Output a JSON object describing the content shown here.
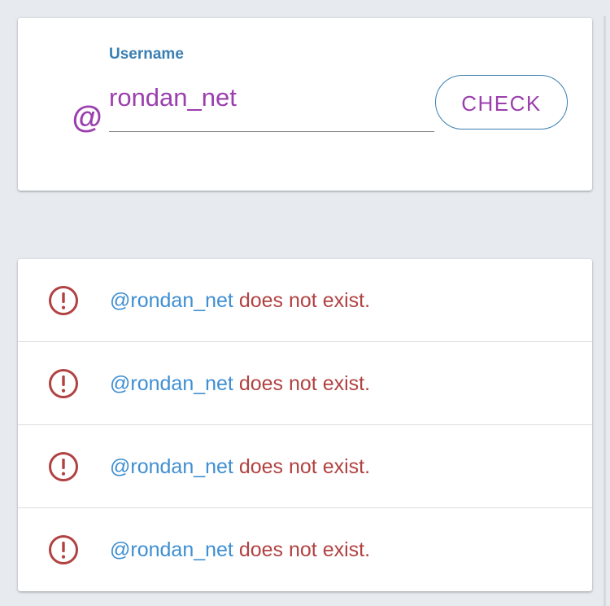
{
  "form": {
    "icon": "at-sign-icon",
    "at_symbol": "@",
    "label": "Username",
    "value": "rondan_net",
    "button_label": "CHECK"
  },
  "results": [
    {
      "icon": "alert-circle-icon",
      "handle": "@rondan_net",
      "message": "does not exist."
    },
    {
      "icon": "alert-circle-icon",
      "handle": "@rondan_net",
      "message": "does not exist."
    },
    {
      "icon": "alert-circle-icon",
      "handle": "@rondan_net",
      "message": "does not exist."
    },
    {
      "icon": "alert-circle-icon",
      "handle": "@rondan_net",
      "message": "does not exist."
    }
  ],
  "colors": {
    "accent": "#9b3fae",
    "primary": "#3a7fb2",
    "handle": "#3f8fd2",
    "error": "#b14242",
    "background": "#e7ebef"
  }
}
